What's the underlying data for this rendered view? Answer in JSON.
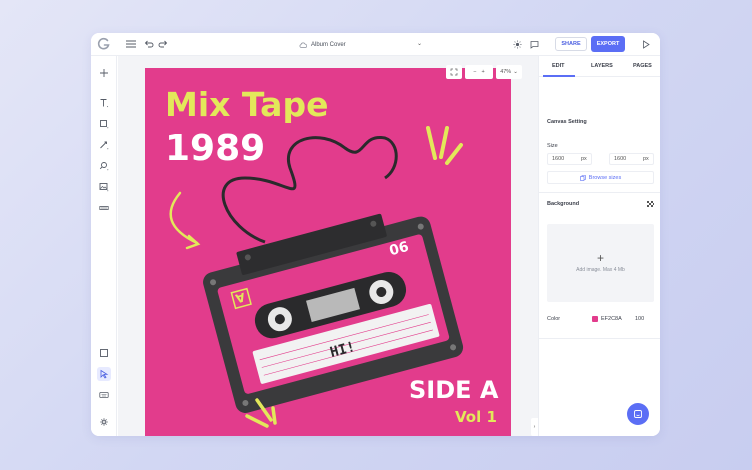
{
  "app": {
    "document_title": "Album Cover"
  },
  "toolbar": {
    "share_label": "SHARE",
    "export_label": "EXPORT"
  },
  "canvas": {
    "zoom_label": "47%",
    "artboard_color": "#E23C8C"
  },
  "artwork": {
    "title_line1": "Mix Tape",
    "title_line2": "1989",
    "side_label": "SIDE A",
    "vol_label": "Vol 1",
    "cassette_label_text": "HI!",
    "cassette_corner_letter": "A",
    "cassette_number": "90"
  },
  "panel": {
    "tabs": [
      {
        "label": "EDIT",
        "active": true
      },
      {
        "label": "LAYERS",
        "active": false
      },
      {
        "label": "PAGES",
        "active": false
      }
    ],
    "canvas_setting_label": "Canvas Setting",
    "size_label": "Size",
    "width_value": "1600",
    "height_value": "1600",
    "unit": "px",
    "browse_sizes_label": "Browse sizes",
    "background_label": "Background",
    "add_image_text": "Add image. Max 4 Mb",
    "color_label": "Color",
    "color_hex": "EF2C8A",
    "opacity_value": "100"
  },
  "colors": {
    "accent": "#5B6EF5",
    "artboard": "#E23C8C",
    "yellow_text": "#E3E85A",
    "cassette_body": "#3A3A3C"
  },
  "icons": {
    "logo": "app-logo-icon",
    "menu": "hamburger-icon",
    "undo": "undo-icon",
    "redo": "redo-icon",
    "cloud": "cloud-icon",
    "theme": "sun-icon",
    "comment": "comment-icon",
    "play": "play-icon"
  }
}
